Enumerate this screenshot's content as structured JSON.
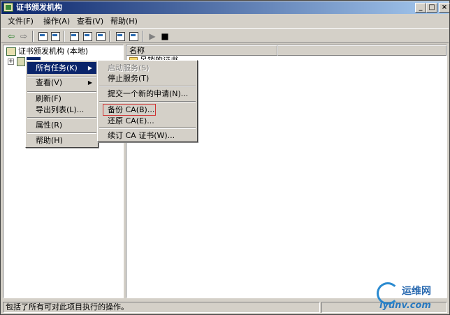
{
  "window": {
    "title": "证书颁发机构"
  },
  "menubar": [
    {
      "label": "文件(F)"
    },
    {
      "label": "操作(A)"
    },
    {
      "label": "查看(V)"
    },
    {
      "label": "帮助(H)"
    }
  ],
  "tree": {
    "root_label": "证书颁发机构 (本地)",
    "expander": "+"
  },
  "list": {
    "column_name": "名称",
    "items": [
      {
        "label": "吊销的证书"
      }
    ]
  },
  "context_menu": {
    "items": [
      {
        "label": "所有任务(K)",
        "arrow": "▶"
      },
      {
        "label": "查看(V)",
        "arrow": "▶"
      },
      {
        "label": "刷新(F)"
      },
      {
        "label": "导出列表(L)..."
      },
      {
        "label": "属性(R)"
      },
      {
        "label": "帮助(H)"
      }
    ]
  },
  "submenu": {
    "items": [
      {
        "label": "启动服务(S)",
        "disabled": true
      },
      {
        "label": "停止服务(T)"
      },
      {
        "label": "提交一个新的申请(N)..."
      },
      {
        "label": "备份 CA(B)...",
        "highlighted_box": true
      },
      {
        "label": "还原 CA(E)..."
      },
      {
        "label": "续订 CA 证书(W)..."
      }
    ]
  },
  "statusbar": {
    "text": "包括了所有可对此项目执行的操作。"
  },
  "watermark": {
    "name": "运维网",
    "url": "iyunv.com"
  },
  "colors": {
    "titlebar_start": "#0a246a",
    "titlebar_end": "#a6caf0",
    "highlight": "#0a246a",
    "face": "#d4d0c8",
    "box": "#d03030"
  }
}
